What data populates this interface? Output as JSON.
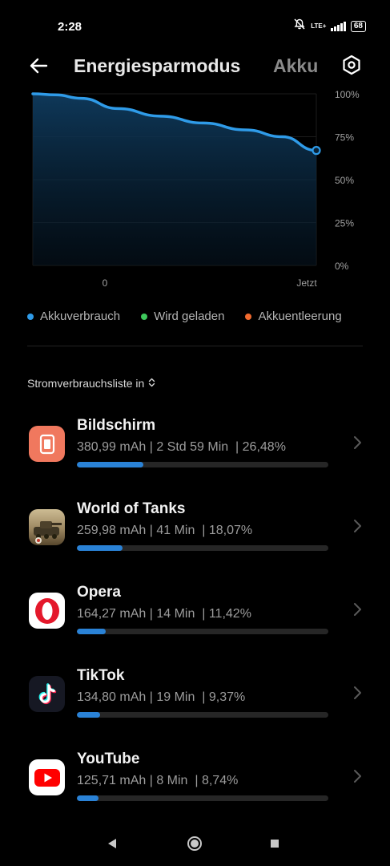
{
  "status_bar": {
    "time": "2:28",
    "network": "LTE+",
    "battery": "68"
  },
  "header": {
    "title": "Energiesparmodus",
    "tab_next": "Akku",
    "back_icon": "back-arrow-icon",
    "settings_icon": "settings-hexagon-icon"
  },
  "chart_data": {
    "type": "area",
    "x_ticks": [
      "0",
      "Jetzt"
    ],
    "y_ticks": [
      "100%",
      "75%",
      "50%",
      "25%",
      "0%"
    ],
    "ylim": [
      0,
      100
    ],
    "series": [
      {
        "x": [
          0,
          0.08,
          0.17,
          0.3,
          0.45,
          0.6,
          0.75,
          0.88,
          1.0
        ],
        "values": [
          100,
          99.4,
          97.4,
          91.4,
          87,
          83,
          79,
          75,
          67
        ]
      }
    ],
    "line_color": "#2f9be8",
    "grid": true
  },
  "legend": [
    {
      "label": "Akkuverbrauch",
      "color": "#2f9be8"
    },
    {
      "label": "Wird geladen",
      "color": "#3ec95c"
    },
    {
      "label": "Akkuentleerung",
      "color": "#f26a2e"
    }
  ],
  "list_header": {
    "label": "Stromverbrauchsliste in",
    "icon": "sort-updown-icon"
  },
  "apps": [
    {
      "name": "Bildschirm",
      "stats": "380,99 mAh | 2 Std 59 Min  | 26,48%",
      "percent": 26.48,
      "icon": "screen-icon"
    },
    {
      "name": "World of Tanks",
      "stats": "259,98 mAh | 41 Min  | 18,07%",
      "percent": 18.07,
      "icon": "world-of-tanks-icon"
    },
    {
      "name": "Opera",
      "stats": "164,27 mAh | 14 Min  | 11,42%",
      "percent": 11.42,
      "icon": "opera-icon"
    },
    {
      "name": "TikTok",
      "stats": "134,80 mAh | 19 Min  | 9,37%",
      "percent": 9.37,
      "icon": "tiktok-icon"
    },
    {
      "name": "YouTube",
      "stats": "125,71 mAh | 8 Min  | 8,74%",
      "percent": 8.74,
      "icon": "youtube-icon"
    }
  ],
  "nav": {
    "back": "nav-back-icon",
    "home": "nav-home-icon",
    "recents": "nav-recents-icon"
  }
}
